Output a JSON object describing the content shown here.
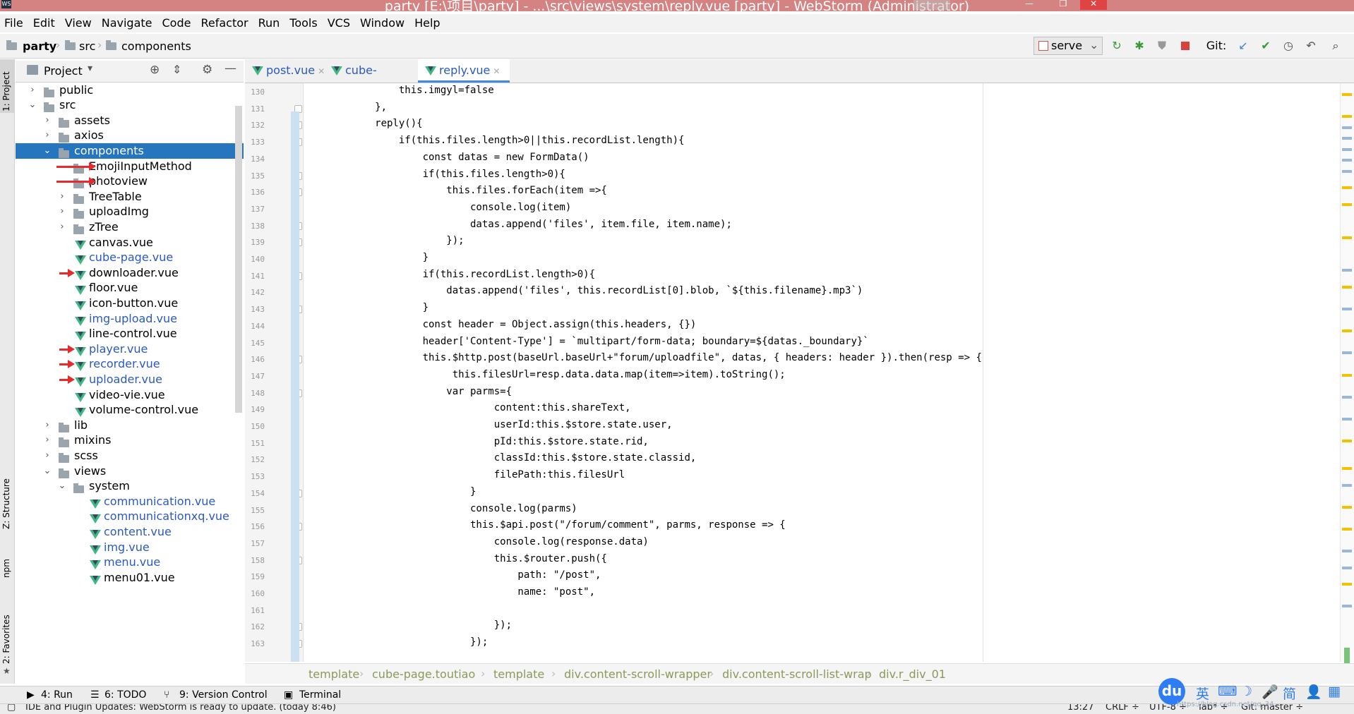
{
  "window": {
    "title": "party [E:\\项目\\party] - ...\\src\\views\\system\\reply.vue [party] - WebStorm (Administrator)",
    "app_icon": "WS"
  },
  "menu": [
    "File",
    "Edit",
    "View",
    "Navigate",
    "Code",
    "Refactor",
    "Run",
    "Tools",
    "VCS",
    "Window",
    "Help"
  ],
  "navbar": {
    "breadcrumb": [
      "party",
      "src",
      "components"
    ],
    "run_config": "serve",
    "git_label": "Git:"
  },
  "tool_strip": {
    "project": "1: Project",
    "structure": "Z: Structure",
    "npm": "npm",
    "favorites": "2: Favorites"
  },
  "project_panel": {
    "title": "Project",
    "tree": [
      {
        "label": "public",
        "type": "folder",
        "depth": 0,
        "arrow": "›"
      },
      {
        "label": "src",
        "type": "folder",
        "depth": 0,
        "arrow": "⌄"
      },
      {
        "label": "assets",
        "type": "folder",
        "depth": 1,
        "arrow": "›"
      },
      {
        "label": "axios",
        "type": "folder",
        "depth": 1,
        "arrow": "›"
      },
      {
        "label": "components",
        "type": "folder",
        "depth": 1,
        "arrow": "⌄",
        "selected": true
      },
      {
        "label": "EmojiInputMethod",
        "type": "folder",
        "depth": 2,
        "arrow": "",
        "annotated": "long"
      },
      {
        "label": "photoview",
        "type": "folder",
        "depth": 2,
        "arrow": "",
        "annotated": "long"
      },
      {
        "label": "TreeTable",
        "type": "folder",
        "depth": 2,
        "arrow": "›"
      },
      {
        "label": "uploadImg",
        "type": "folder",
        "depth": 2,
        "arrow": "›"
      },
      {
        "label": "zTree",
        "type": "folder",
        "depth": 2,
        "arrow": "›"
      },
      {
        "label": "canvas.vue",
        "type": "vue",
        "depth": 2
      },
      {
        "label": "cube-page.vue",
        "type": "vue",
        "depth": 2,
        "modified": true
      },
      {
        "label": "downloader.vue",
        "type": "vue",
        "depth": 2,
        "annotated": "short"
      },
      {
        "label": "floor.vue",
        "type": "vue",
        "depth": 2
      },
      {
        "label": "icon-button.vue",
        "type": "vue",
        "depth": 2
      },
      {
        "label": "img-upload.vue",
        "type": "vue",
        "depth": 2,
        "modified": true
      },
      {
        "label": "line-control.vue",
        "type": "vue",
        "depth": 2
      },
      {
        "label": "player.vue",
        "type": "vue",
        "depth": 2,
        "modified": true,
        "annotated": "short"
      },
      {
        "label": "recorder.vue",
        "type": "vue",
        "depth": 2,
        "modified": true,
        "annotated": "short"
      },
      {
        "label": "uploader.vue",
        "type": "vue",
        "depth": 2,
        "modified": true,
        "annotated": "short"
      },
      {
        "label": "video-vie.vue",
        "type": "vue",
        "depth": 2
      },
      {
        "label": "volume-control.vue",
        "type": "vue",
        "depth": 2
      },
      {
        "label": "lib",
        "type": "folder",
        "depth": 1,
        "arrow": "›"
      },
      {
        "label": "mixins",
        "type": "folder",
        "depth": 1,
        "arrow": "›"
      },
      {
        "label": "scss",
        "type": "folder",
        "depth": 1,
        "arrow": "›"
      },
      {
        "label": "views",
        "type": "folder",
        "depth": 1,
        "arrow": "⌄"
      },
      {
        "label": "system",
        "type": "folder",
        "depth": 2,
        "arrow": "⌄"
      },
      {
        "label": "communication.vue",
        "type": "vue",
        "depth": 3,
        "modified": true
      },
      {
        "label": "communicationxq.vue",
        "type": "vue",
        "depth": 3,
        "modified": true
      },
      {
        "label": "content.vue",
        "type": "vue",
        "depth": 3,
        "modified": true
      },
      {
        "label": "img.vue",
        "type": "vue",
        "depth": 3,
        "modified": true
      },
      {
        "label": "menu.vue",
        "type": "vue",
        "depth": 3,
        "modified": true
      },
      {
        "label": "menu01.vue",
        "type": "vue",
        "depth": 3,
        "modified": false
      }
    ]
  },
  "tabs": [
    {
      "label": "post.vue",
      "active": false
    },
    {
      "label": "cube-page.vue",
      "active": false
    },
    {
      "label": "reply.vue",
      "active": true
    }
  ],
  "code": {
    "lines": [
      {
        "n": "130",
        "text": "                this.imgyl=false"
      },
      {
        "n": "131",
        "text": "            },"
      },
      {
        "n": "132",
        "text": "            reply(){"
      },
      {
        "n": "133",
        "text": "                if(this.files.length>0||this.recordList.length){"
      },
      {
        "n": "134",
        "text": "                    const datas = new FormData()"
      },
      {
        "n": "135",
        "text": "                    if(this.files.length>0){"
      },
      {
        "n": "136",
        "text": "                        this.files.forEach(item =>{"
      },
      {
        "n": "137",
        "text": "                            console.log(item)"
      },
      {
        "n": "138",
        "text": "                            datas.append('files', item.file, item.name);"
      },
      {
        "n": "139",
        "text": "                        });"
      },
      {
        "n": "140",
        "text": "                    }"
      },
      {
        "n": "141",
        "text": "                    if(this.recordList.length>0){"
      },
      {
        "n": "142",
        "text": "                        datas.append('files', this.recordList[0].blob, `${this.filename}.mp3`)"
      },
      {
        "n": "143",
        "text": "                    }"
      },
      {
        "n": "144",
        "text": "                    const header = Object.assign(this.headers, {})"
      },
      {
        "n": "145",
        "text": "                    header['Content-Type'] = `multipart/form-data; boundary=${datas._boundary}`"
      },
      {
        "n": "146",
        "text": "                    this.$http.post(baseUrl.baseUrl+\"forum/uploadfile\", datas, { headers: header }).then(resp => {"
      },
      {
        "n": "147",
        "text": "                         this.filesUrl=resp.data.data.map(item=>item).toString();"
      },
      {
        "n": "148",
        "text": "                        var parms={"
      },
      {
        "n": "149",
        "text": "                                content:this.shareText,"
      },
      {
        "n": "150",
        "text": "                                userId:this.$store.state.user,"
      },
      {
        "n": "151",
        "text": "                                pId:this.$store.state.rid,"
      },
      {
        "n": "152",
        "text": "                                classId:this.$store.state.classid,"
      },
      {
        "n": "153",
        "text": "                                filePath:this.filesUrl"
      },
      {
        "n": "154",
        "text": "                            }"
      },
      {
        "n": "155",
        "text": "                            console.log(parms)"
      },
      {
        "n": "156",
        "text": "                            this.$api.post(\"/forum/comment\", parms, response => {"
      },
      {
        "n": "157",
        "text": "                                console.log(response.data)"
      },
      {
        "n": "158",
        "text": "                                this.$router.push({"
      },
      {
        "n": "159",
        "text": "                                    path: \"/post\","
      },
      {
        "n": "160",
        "text": "                                    name: \"post\","
      },
      {
        "n": "161",
        "text": ""
      },
      {
        "n": "162",
        "text": "                                });"
      },
      {
        "n": "163",
        "text": "                            });"
      }
    ]
  },
  "editor_breadcrumb": [
    "template",
    "cube-page.toutiao",
    "template",
    "div.content-scroll-wrapper",
    "div.content-scroll-list-wrap",
    "div.r_div_01"
  ],
  "bottom_tools": [
    {
      "key": "4",
      "label": "4: Run"
    },
    {
      "key": "6",
      "label": "6: TODO"
    },
    {
      "key": "9",
      "label": "9: Version Control"
    },
    {
      "key": "",
      "label": "Terminal"
    }
  ],
  "status": {
    "message": "IDE and Plugin Updates: WebStorm is ready to update. (today 8:46)",
    "position": "13:27",
    "line_sep": "CRLF ÷",
    "encoding": "UTF-8 ÷",
    "indent": "Tab* ÷",
    "branch": "Git: master ÷"
  },
  "ime": {
    "logo": "du",
    "items": [
      "英",
      "⌨",
      "☽",
      "🎤",
      "简",
      "👤",
      "▦"
    ],
    "watermark": "https://blog.csdn.net/qq_34..."
  },
  "colors": {
    "titlebar": "#d48282",
    "selection": "#2675bf",
    "modified_file": "#2b59c3",
    "keyword": "#000080",
    "string": "#008000",
    "annotation_arrow": "#e52b2b"
  }
}
